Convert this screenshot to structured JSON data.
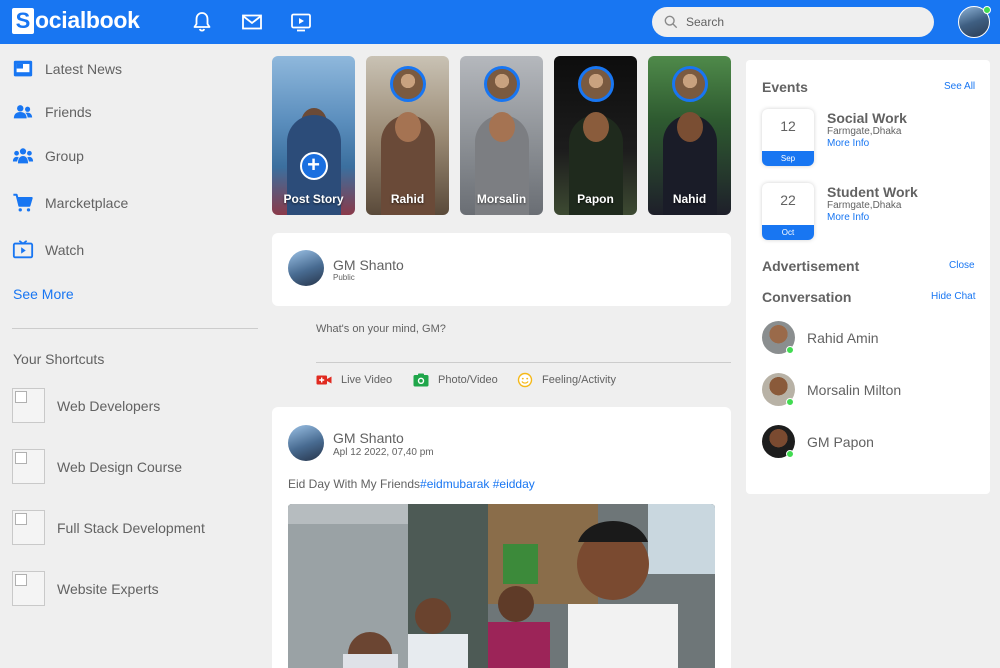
{
  "navbar": {
    "logo_letter": "S",
    "logo_text": "ocialbook",
    "search_placeholder": "Search",
    "icons": [
      "bell-icon",
      "mail-icon",
      "video-icon",
      "search-icon"
    ],
    "colors": {
      "brand": "#1876f2",
      "online": "#41db51"
    }
  },
  "left": {
    "items": [
      {
        "label": "Latest News",
        "icon": "news-icon"
      },
      {
        "label": "Friends",
        "icon": "friends-icon"
      },
      {
        "label": "Group",
        "icon": "group-icon"
      },
      {
        "label": "Marcketplace",
        "icon": "cart-icon"
      },
      {
        "label": "Watch",
        "icon": "tv-icon"
      }
    ],
    "see_more": "See More",
    "shortcuts_title": "Your Shortcuts",
    "shortcuts": [
      "Web Developers",
      "Web Design Course",
      "Full Stack Development",
      "Website Experts"
    ]
  },
  "stories": [
    {
      "label": "Post Story"
    },
    {
      "label": "Rahid"
    },
    {
      "label": "Morsalin"
    },
    {
      "label": "Papon"
    },
    {
      "label": "Nahid"
    }
  ],
  "composer": {
    "name": "GM Shanto",
    "privacy": "Public",
    "placeholder": "What's on your mind, GM?",
    "actions": [
      {
        "label": "Live Video",
        "icon": "live-video-icon",
        "color": "#e02a20"
      },
      {
        "label": "Photo/Video",
        "icon": "photo-icon",
        "color": "#1fa64a"
      },
      {
        "label": "Feeling/Activity",
        "icon": "feeling-icon",
        "color": "#f5b818"
      }
    ]
  },
  "post": {
    "name": "GM Shanto",
    "time": "Apl 12 2022, 07,40 pm",
    "text": "Eid Day With My Friends",
    "tags": "#eidmubarak #eidday"
  },
  "right": {
    "events_title": "Events",
    "see_all": "See All",
    "events": [
      {
        "day": "12",
        "month": "Sep",
        "name": "Social Work",
        "location": "Farmgate,Dhaka",
        "more": "More Info"
      },
      {
        "day": "22",
        "month": "Oct",
        "name": "Student Work",
        "location": "Farmgate,Dhaka",
        "more": "More Info"
      }
    ],
    "ad_title": "Advertisement",
    "close": "Close",
    "conv_title": "Conversation",
    "hide_chat": "Hide Chat",
    "conversations": [
      "Rahid Amin",
      "Morsalin Milton",
      "GM Papon"
    ]
  }
}
